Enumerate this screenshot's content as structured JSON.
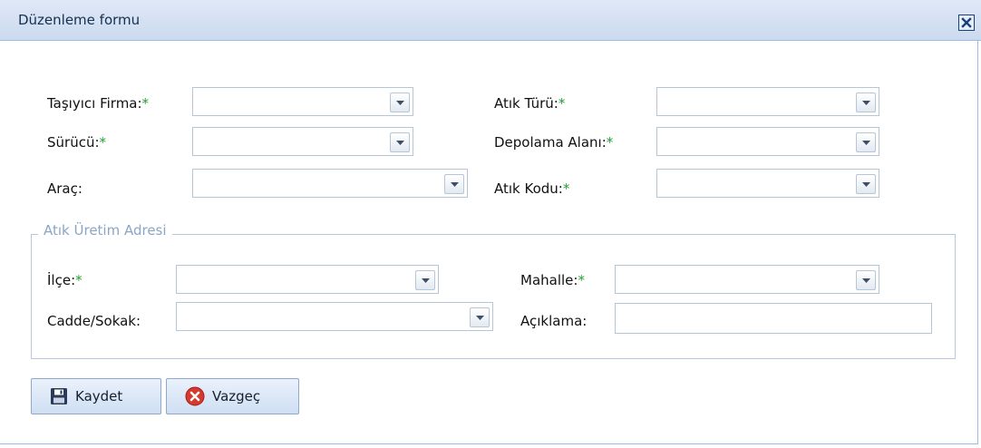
{
  "window": {
    "title": "Düzenleme formu"
  },
  "form": {
    "required_mark": "*",
    "left_fields": [
      {
        "label": "Taşıyıcı Firma:",
        "required": true,
        "value": ""
      },
      {
        "label": "Sürücü:",
        "required": true,
        "value": ""
      },
      {
        "label": "Araç:",
        "required": false,
        "value": ""
      }
    ],
    "right_fields": [
      {
        "label": "Atık Türü:",
        "required": true,
        "value": ""
      },
      {
        "label": "Depolama Alanı:",
        "required": true,
        "value": ""
      },
      {
        "label": "Atık Kodu:",
        "required": true,
        "value": ""
      }
    ],
    "address": {
      "legend": "Atık Üretim Adresi",
      "ilce": {
        "label": "İlçe:",
        "required": true,
        "value": ""
      },
      "cadde": {
        "label": "Cadde/Sokak:",
        "required": false,
        "value": ""
      },
      "mahalle": {
        "label": "Mahalle:",
        "required": true,
        "value": ""
      },
      "aciklama": {
        "label": "Açıklama:",
        "required": false,
        "value": ""
      }
    }
  },
  "buttons": {
    "save": "Kaydet",
    "cancel": "Vazgeç"
  },
  "icons": {
    "close": "close-icon",
    "save": "floppy-disk-icon",
    "cancel": "cancel-icon",
    "dropdown": "chevron-down-icon"
  },
  "colors": {
    "title_bar": "#dfe8f6",
    "border": "#99bbe8",
    "required": "#22a033",
    "cancel_icon": "#d63a2f"
  }
}
